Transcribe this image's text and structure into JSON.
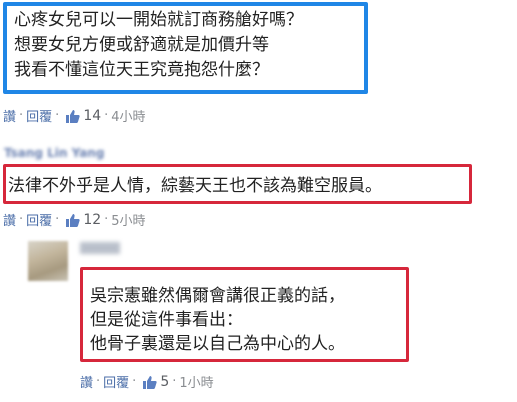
{
  "comment1": {
    "lines": [
      "心疼女兒可以一開始就訂商務艙好嗎？",
      "想要女兒方便或舒適就是加價升等",
      "我看不懂這位天王究竟抱怨什麼？"
    ],
    "actions": {
      "read": "讚",
      "reply": "回覆",
      "likes": "14",
      "time": "4小時"
    }
  },
  "comment2": {
    "author": "Tsang Lin Yang",
    "text": "法律不外乎是人情，綜藝天王也不該為難空服員。",
    "actions": {
      "read": "讚",
      "reply": "回覆",
      "likes": "12",
      "time": "5小時"
    }
  },
  "comment3": {
    "lines": [
      "吳宗憲雖然偶爾會講很正義的話，",
      "但是從這件事看出：",
      "他骨子裏還是以自己為中心的人。"
    ],
    "actions": {
      "read": "讚",
      "reply": "回覆",
      "likes": "5",
      "time": "1小時"
    }
  },
  "colors": {
    "highlight_blue": "#1f86e6",
    "highlight_red": "#d6273b",
    "link": "#4b6ea8"
  },
  "icons": {
    "like": "thumbs-up-icon"
  }
}
